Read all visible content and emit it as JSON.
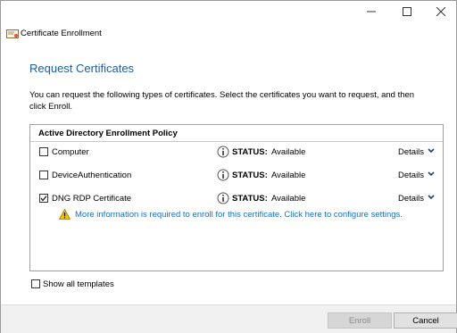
{
  "window": {
    "title": "Certificate Enrollment"
  },
  "page": {
    "heading": "Request Certificates",
    "intro": "You can request the following types of certificates. Select the certificates you want to request, and then click Enroll."
  },
  "policy": {
    "header": "Active Directory Enrollment Policy",
    "status_label": "STATUS:",
    "details_label": "Details",
    "items": [
      {
        "name": "Computer",
        "status": "Available",
        "checked": false
      },
      {
        "name": "DeviceAuthentication",
        "status": "Available",
        "checked": false
      },
      {
        "name": "DNG RDP Certificate",
        "status": "Available",
        "checked": true
      }
    ],
    "warning_text": "More information is required to enroll for this certificate. Click here to configure settings."
  },
  "options": {
    "show_all_templates_label": "Show all templates",
    "show_all_templates_checked": false
  },
  "buttons": {
    "enroll": "Enroll",
    "cancel": "Cancel",
    "enroll_enabled": false
  },
  "colors": {
    "heading": "#1a5ea8",
    "link": "#1a6fc4",
    "warning": "#f5c400"
  },
  "icons": {
    "app": "certificate-icon",
    "info": "info-icon",
    "warning": "warning-icon",
    "details": "chevron-down-icon"
  }
}
